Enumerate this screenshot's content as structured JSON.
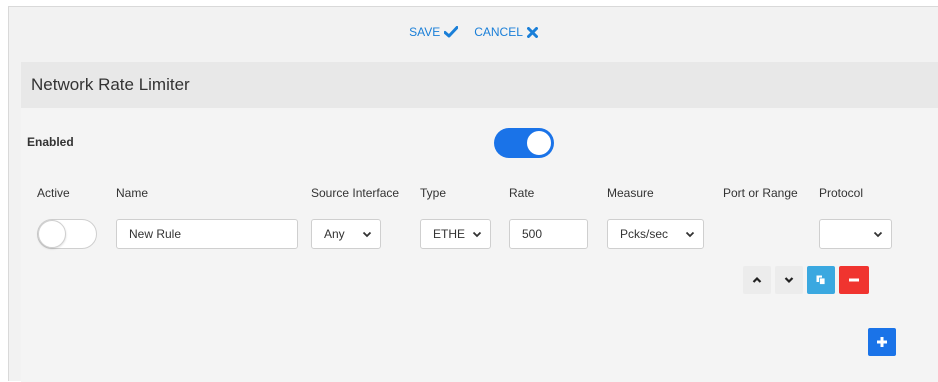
{
  "toolbar": {
    "save_label": "SAVE",
    "cancel_label": "CANCEL"
  },
  "panel": {
    "title": "Network Rate Limiter",
    "enabled_label": "Enabled",
    "enabled_value": true
  },
  "columns": {
    "active": "Active",
    "name": "Name",
    "source_interface": "Source Interface",
    "type": "Type",
    "rate": "Rate",
    "measure": "Measure",
    "port_or_range": "Port or Range",
    "protocol": "Protocol"
  },
  "rule": {
    "active": false,
    "name": "New Rule",
    "source_interface": "Any",
    "type": "ETHE",
    "rate": "500",
    "measure": "Pcks/sec",
    "protocol": ""
  },
  "icons": {
    "save": "check-icon",
    "cancel": "x-icon",
    "move_up": "chevron-up-icon",
    "move_down": "chevron-down-icon",
    "copy": "copy-icon",
    "remove": "minus-icon",
    "add": "plus-icon"
  },
  "colors": {
    "accent": "#1a73e8",
    "link": "#1a7fd8",
    "copy_button": "#3aa8e0",
    "remove_button": "#f0342f"
  }
}
